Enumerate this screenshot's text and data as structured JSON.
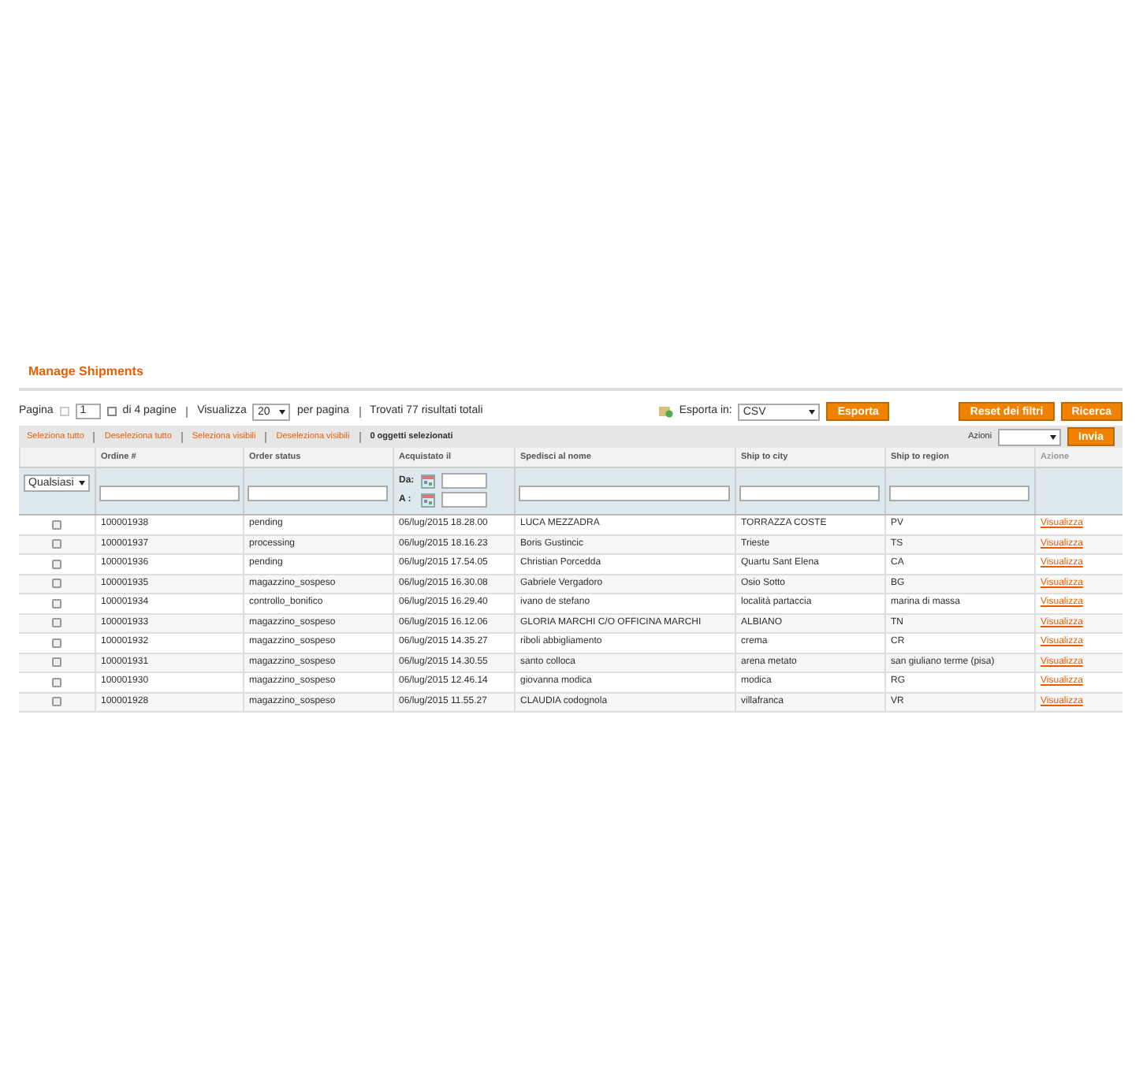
{
  "title": "Manage Shipments",
  "pager": {
    "label": "Pagina",
    "page": "1",
    "of_pages": "di 4 pagine",
    "view_label": "Visualizza",
    "per_page": "20",
    "per_page_label": "per pagina",
    "found": "Trovati 77 risultati totali"
  },
  "export": {
    "label": "Esporta in:",
    "format": "CSV",
    "button": "Esporta"
  },
  "buttons": [
    "Reset dei filtri",
    "Ricerca"
  ],
  "massaction": {
    "links": [
      "Seleziona tutto",
      "Deseleziona tutto",
      "Seleziona visibili",
      "Deseleziona visibili"
    ],
    "count": "0 oggetti selezionati",
    "actions_label": "Azioni",
    "submit": "Invia"
  },
  "columns": [
    "",
    "Ordine #",
    "Order status",
    "Acquistato il",
    "Spedisci al nome",
    "Ship to city",
    "Ship to region",
    "Azione"
  ],
  "filters": {
    "any": "Qualsiasi",
    "from_label": "Da:",
    "to_label": "A :"
  },
  "rows": [
    {
      "checked": false,
      "order": "100001938",
      "status": "pending",
      "date": "06/lug/2015 18.28.00",
      "name": "LUCA MEZZADRA",
      "city": "TORRAZZA COSTE",
      "region": "PV",
      "action": "Visualizza"
    },
    {
      "checked": false,
      "order": "100001937",
      "status": "processing",
      "date": "06/lug/2015 18.16.23",
      "name": "Boris Gustincic",
      "city": "Trieste",
      "region": "TS",
      "action": "Visualizza"
    },
    {
      "checked": false,
      "order": "100001936",
      "status": "pending",
      "date": "06/lug/2015 17.54.05",
      "name": "Christian Porcedda",
      "city": "Quartu Sant Elena",
      "region": "CA",
      "action": "Visualizza"
    },
    {
      "checked": false,
      "order": "100001935",
      "status": "magazzino_sospeso",
      "date": "06/lug/2015 16.30.08",
      "name": "Gabriele Vergadoro",
      "city": "Osio Sotto",
      "region": "BG",
      "action": "Visualizza"
    },
    {
      "checked": false,
      "order": "100001934",
      "status": "controllo_bonifico",
      "date": "06/lug/2015 16.29.40",
      "name": "ivano de stefano",
      "city": "località partaccia",
      "region": "marina di massa",
      "action": "Visualizza"
    },
    {
      "checked": false,
      "order": "100001933",
      "status": "magazzino_sospeso",
      "date": "06/lug/2015 16.12.06",
      "name": "GLORIA MARCHI C/O OFFICINA MARCHI",
      "city": "ALBIANO",
      "region": "TN",
      "action": "Visualizza"
    },
    {
      "checked": false,
      "order": "100001932",
      "status": "magazzino_sospeso",
      "date": "06/lug/2015 14.35.27",
      "name": "riboli abbigliamento",
      "city": "crema",
      "region": "CR",
      "action": "Visualizza"
    },
    {
      "checked": false,
      "order": "100001931",
      "status": "magazzino_sospeso",
      "date": "06/lug/2015 14.30.55",
      "name": "santo colloca",
      "city": "arena metato",
      "region": "san giuliano terme (pisa)",
      "action": "Visualizza"
    },
    {
      "checked": false,
      "order": "100001930",
      "status": "magazzino_sospeso",
      "date": "06/lug/2015 12.46.14",
      "name": "giovanna modica",
      "city": "modica",
      "region": "RG",
      "action": "Visualizza"
    },
    {
      "checked": false,
      "order": "100001928",
      "status": "magazzino_sospeso",
      "date": "06/lug/2015 11.55.27",
      "name": "CLAUDIA codognola",
      "city": "villafranca",
      "region": "VR",
      "action": "Visualizza"
    }
  ]
}
